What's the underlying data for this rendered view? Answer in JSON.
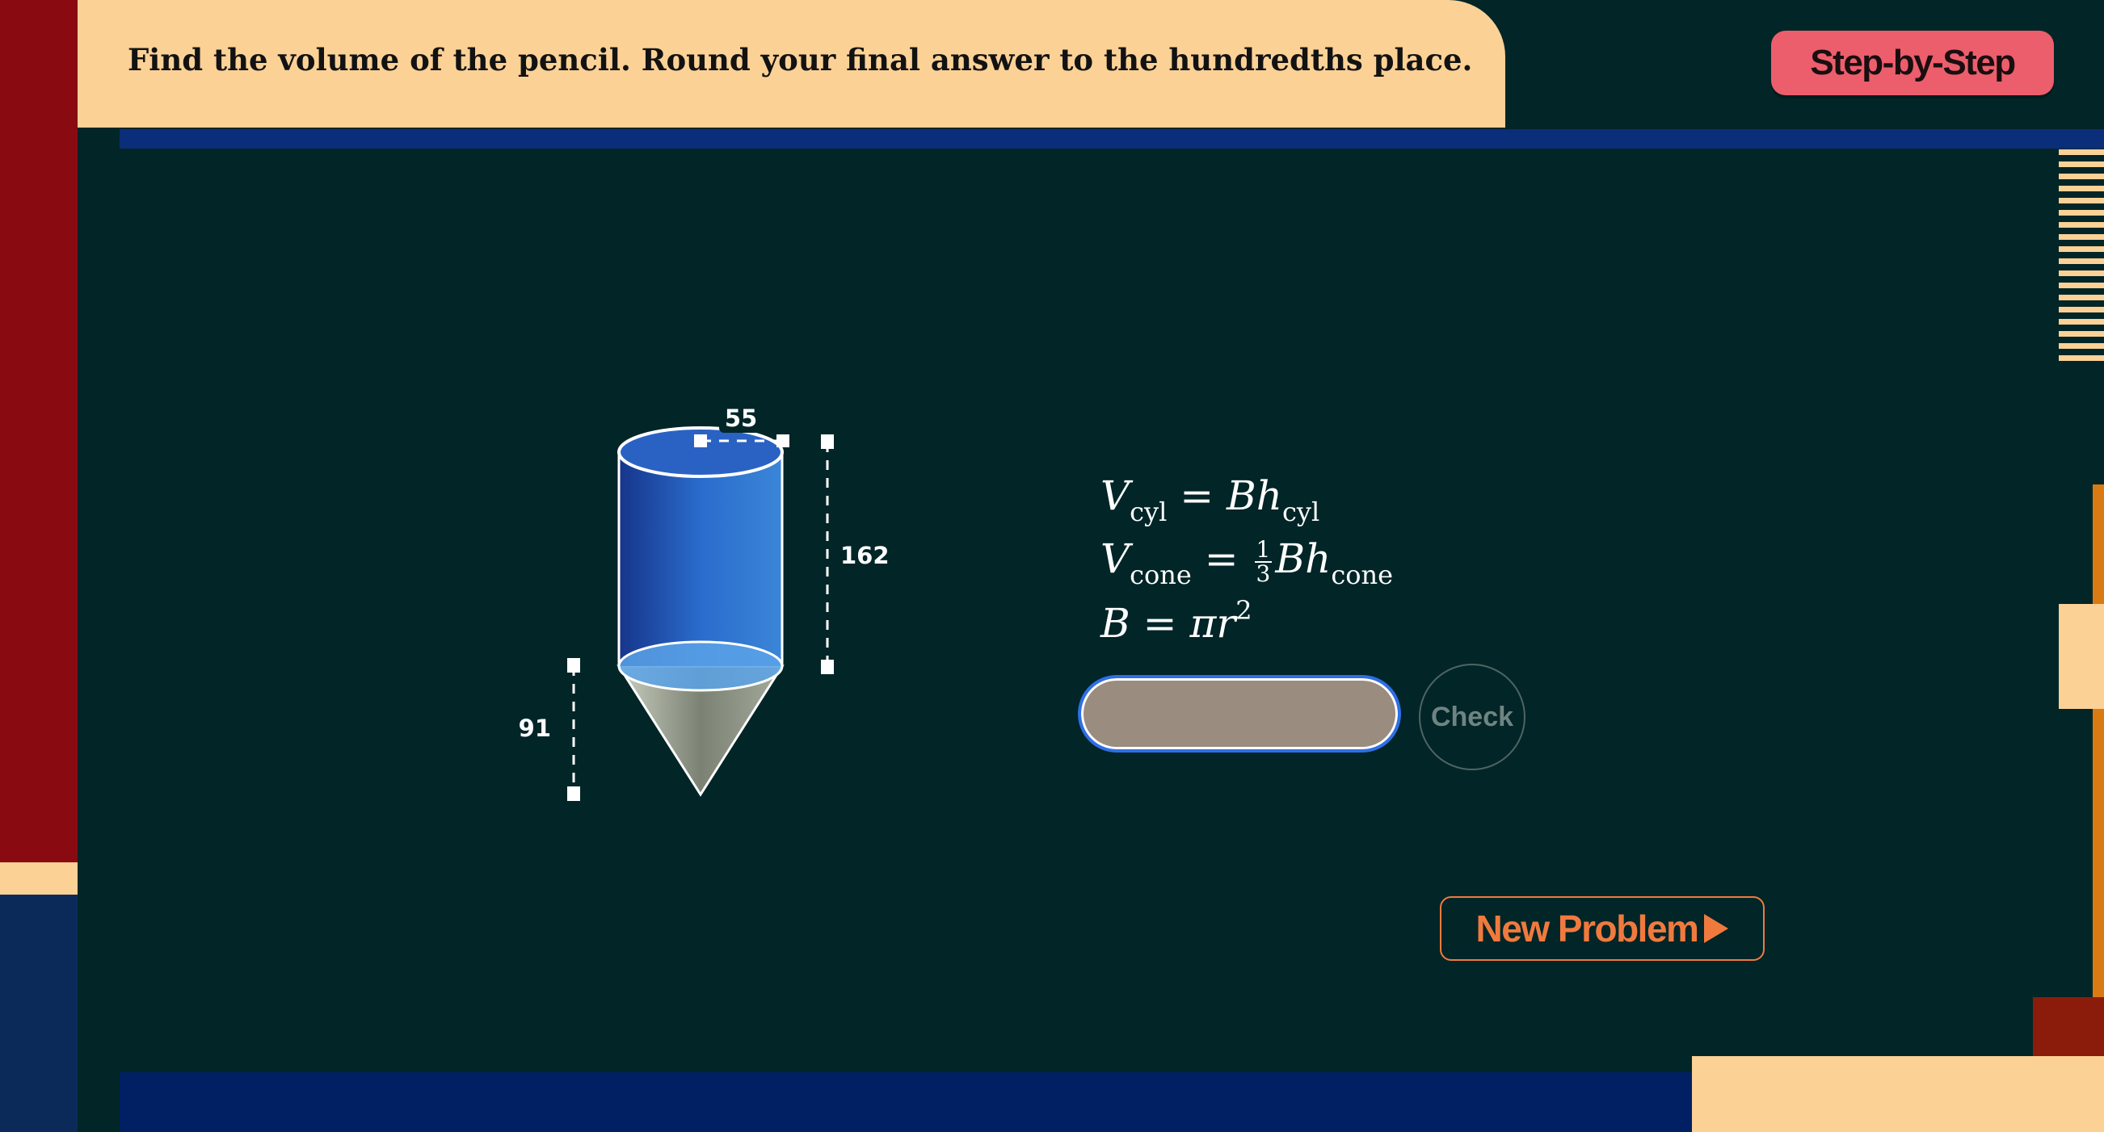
{
  "prompt": "Find the volume of the pencil. Round your final answer to the hundredths place.",
  "step_button_label": "Step-by-Step",
  "figure": {
    "diameter_label": "55",
    "cylinder_height_label": "162",
    "cone_height_label": "91"
  },
  "formulas": {
    "cyl": {
      "v": "V",
      "v_sub": "cyl",
      "eq": " = ",
      "b": "B",
      "h": "h",
      "h_sub": "cyl"
    },
    "cone": {
      "v": "V",
      "v_sub": "cone",
      "eq": " = ",
      "num": "1",
      "den": "3",
      "b": "B",
      "h": "h",
      "h_sub": "cone"
    },
    "base": {
      "b": "B",
      "eq": " = ",
      "pi": "π",
      "r": "r",
      "exp": "2"
    }
  },
  "answer": {
    "value": "",
    "placeholder": ""
  },
  "check_label": "Check",
  "new_problem_label": "New Problem",
  "colors": {
    "board": "#022527",
    "cream": "#fbd196",
    "step_button": "#ec5e6c",
    "accent_orange": "#f07a3e",
    "input_border": "#2e6fe6",
    "cylinder_blue": "#2e6fc9"
  },
  "icons": [
    "play-icon"
  ]
}
